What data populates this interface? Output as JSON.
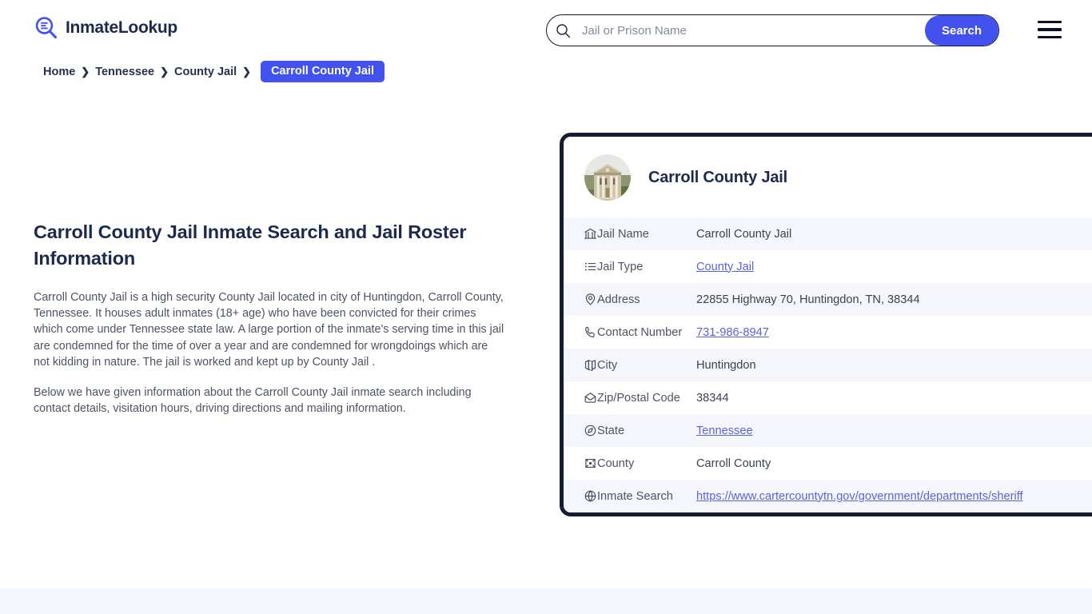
{
  "header": {
    "brand_name": "InmateLookup",
    "brand_icon": "magnifier-list-icon",
    "search": {
      "placeholder": "Jail or Prison Name",
      "value": "",
      "button_label": "Search",
      "icon": "search-icon"
    },
    "menu_icon": "hamburger-menu-icon"
  },
  "breadcrumb": {
    "items": [
      {
        "label": "Home",
        "current": false
      },
      {
        "label": "Tennessee",
        "current": false
      },
      {
        "label": "County Jail",
        "current": false
      },
      {
        "label": "Carroll County Jail",
        "current": true
      }
    ],
    "separator": "❯"
  },
  "article": {
    "heading": "Carroll County Jail Inmate Search and Jail Roster Information",
    "paragraphs": [
      "Carroll County Jail is a high security County Jail located in city of Huntingdon, Carroll County, Tennessee. It houses adult inmates (18+ age) who have been convicted for their crimes which come under Tennessee state law. A large portion of the inmate's serving time in this jail are condemned for the time of over a year and are condemned for wrongdoings which are not kidding in nature. The jail is worked and kept up by County Jail .",
      "Below we have given information about the Carroll County Jail inmate search including contact details, visitation hours, driving directions and mailing information."
    ]
  },
  "info_card": {
    "avatar_icon": "courthouse-building-photo",
    "title": "Carroll County Jail",
    "rows": [
      {
        "icon": "bank-icon",
        "label": "Jail Name",
        "value": "Carroll County Jail",
        "link": false
      },
      {
        "icon": "list-icon",
        "label": "Jail Type",
        "value": "County Jail",
        "link": true
      },
      {
        "icon": "map-pin-icon",
        "label": "Address",
        "value": "22855 Highway 70, Huntingdon, TN, 38344",
        "link": false
      },
      {
        "icon": "phone-icon",
        "label": "Contact Number",
        "value": "731-986-8947",
        "link": true
      },
      {
        "icon": "map-icon",
        "label": "City",
        "value": "Huntingdon",
        "link": false
      },
      {
        "icon": "envelope-icon",
        "label": "Zip/Postal Code",
        "value": "38344",
        "link": false
      },
      {
        "icon": "compass-icon",
        "label": "State",
        "value": "Tennessee",
        "link": true
      },
      {
        "icon": "county-seal-icon",
        "label": "County",
        "value": "Carroll County",
        "link": false
      },
      {
        "icon": "globe-icon",
        "label": "Inmate Search",
        "value": "https://www.cartercountytn.gov/government/departments/sheriff",
        "link": true
      }
    ]
  },
  "colors": {
    "accent_blue": "#4351ef",
    "link_blue": "#5a64d8",
    "card_border": "#121c33",
    "heading_navy": "#1c2a4e",
    "row_stripe": "#f5f6fc",
    "footer_band": "#f6f7fd"
  }
}
